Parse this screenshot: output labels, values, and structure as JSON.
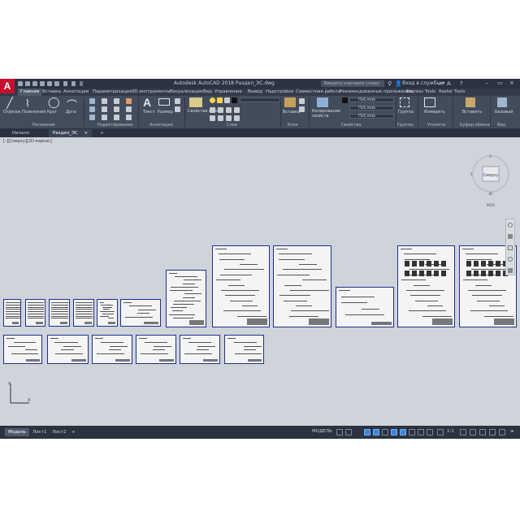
{
  "app": {
    "logo": "A",
    "title": "Autodesk AutoCAD 2018   Раздел_ЭС.dwg",
    "search_placeholder": "Введите ключевое слово/фразу",
    "signin": "Вход в службы"
  },
  "ribbon_tabs": [
    "Главная",
    "Вставка",
    "Аннотации",
    "Параметризация",
    "3D инструменты",
    "Визуализация",
    "Вид",
    "Управление",
    "Вывод",
    "Надстройки",
    "Совместная работа",
    "Рекомендованные приложения",
    "Express Tools",
    "Raster Tools"
  ],
  "panels": {
    "draw": {
      "title": "Рисование",
      "tools": [
        "Отрезок",
        "Полилиния",
        "Круг",
        "Дуга"
      ]
    },
    "modify": {
      "title": "Редактирование"
    },
    "annotation": {
      "title": "Аннотации",
      "tools": [
        "Текст",
        "Размер"
      ]
    },
    "layers": {
      "title": "Слои",
      "tools": [
        "Свойства слоя"
      ]
    },
    "block": {
      "title": "Блок",
      "tools": [
        "Вставка"
      ]
    },
    "properties": {
      "title": "Свойства",
      "tools": [
        "Копирование свойств"
      ],
      "combos": [
        "ПоСлою",
        "ПоСлою",
        "ПоСлою"
      ]
    },
    "groups": {
      "title": "Группы",
      "tools": [
        "Группа"
      ]
    },
    "utilities": {
      "title": "Утилиты",
      "tools": [
        "Измерить"
      ]
    },
    "clipboard": {
      "title": "Буфер обмена",
      "tools": [
        "Вставить"
      ]
    },
    "view": {
      "title": "Вид",
      "tools": [
        "Базовый"
      ]
    }
  },
  "file_tabs": [
    "Начало",
    "Раздел_ЭС"
  ],
  "view_label": "[–][Сверху][2D-каркас]",
  "viewcube": {
    "face": "Сверху",
    "n": "С",
    "s": "Ю",
    "w": "З",
    "e": "В",
    "wcs": "МСК"
  },
  "ucs": {
    "x": "X",
    "y": "Y"
  },
  "layout_tabs": [
    "Модель",
    "Лист1",
    "Лист2"
  ],
  "status": {
    "model": "МОДЕЛЬ",
    "scale": "1:1"
  },
  "colors": {
    "app_bg": "#3b4453",
    "canvas": "#cfd3da",
    "sheet_border": "#1f2f8f",
    "accent": "#3d86d6"
  }
}
